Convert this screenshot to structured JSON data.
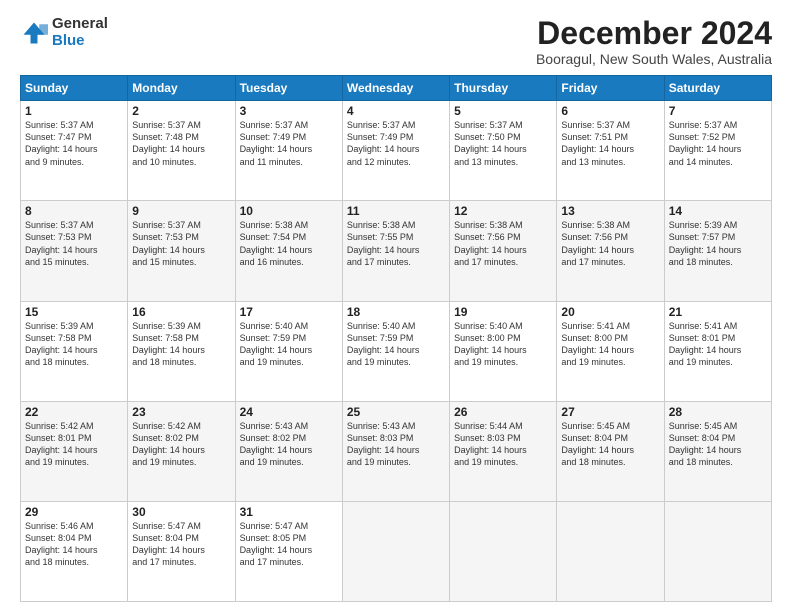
{
  "logo": {
    "general": "General",
    "blue": "Blue"
  },
  "header": {
    "title": "December 2024",
    "subtitle": "Booragul, New South Wales, Australia"
  },
  "weekdays": [
    "Sunday",
    "Monday",
    "Tuesday",
    "Wednesday",
    "Thursday",
    "Friday",
    "Saturday"
  ],
  "weeks": [
    [
      {
        "day": "1",
        "sunrise": "5:37 AM",
        "sunset": "7:47 PM",
        "daylight": "14 hours and 9 minutes."
      },
      {
        "day": "2",
        "sunrise": "5:37 AM",
        "sunset": "7:48 PM",
        "daylight": "14 hours and 10 minutes."
      },
      {
        "day": "3",
        "sunrise": "5:37 AM",
        "sunset": "7:49 PM",
        "daylight": "14 hours and 11 minutes."
      },
      {
        "day": "4",
        "sunrise": "5:37 AM",
        "sunset": "7:49 PM",
        "daylight": "14 hours and 12 minutes."
      },
      {
        "day": "5",
        "sunrise": "5:37 AM",
        "sunset": "7:50 PM",
        "daylight": "14 hours and 13 minutes."
      },
      {
        "day": "6",
        "sunrise": "5:37 AM",
        "sunset": "7:51 PM",
        "daylight": "14 hours and 13 minutes."
      },
      {
        "day": "7",
        "sunrise": "5:37 AM",
        "sunset": "7:52 PM",
        "daylight": "14 hours and 14 minutes."
      }
    ],
    [
      {
        "day": "8",
        "sunrise": "5:37 AM",
        "sunset": "7:53 PM",
        "daylight": "14 hours and 15 minutes."
      },
      {
        "day": "9",
        "sunrise": "5:37 AM",
        "sunset": "7:53 PM",
        "daylight": "14 hours and 15 minutes."
      },
      {
        "day": "10",
        "sunrise": "5:38 AM",
        "sunset": "7:54 PM",
        "daylight": "14 hours and 16 minutes."
      },
      {
        "day": "11",
        "sunrise": "5:38 AM",
        "sunset": "7:55 PM",
        "daylight": "14 hours and 17 minutes."
      },
      {
        "day": "12",
        "sunrise": "5:38 AM",
        "sunset": "7:56 PM",
        "daylight": "14 hours and 17 minutes."
      },
      {
        "day": "13",
        "sunrise": "5:38 AM",
        "sunset": "7:56 PM",
        "daylight": "14 hours and 17 minutes."
      },
      {
        "day": "14",
        "sunrise": "5:39 AM",
        "sunset": "7:57 PM",
        "daylight": "14 hours and 18 minutes."
      }
    ],
    [
      {
        "day": "15",
        "sunrise": "5:39 AM",
        "sunset": "7:58 PM",
        "daylight": "14 hours and 18 minutes."
      },
      {
        "day": "16",
        "sunrise": "5:39 AM",
        "sunset": "7:58 PM",
        "daylight": "14 hours and 18 minutes."
      },
      {
        "day": "17",
        "sunrise": "5:40 AM",
        "sunset": "7:59 PM",
        "daylight": "14 hours and 19 minutes."
      },
      {
        "day": "18",
        "sunrise": "5:40 AM",
        "sunset": "7:59 PM",
        "daylight": "14 hours and 19 minutes."
      },
      {
        "day": "19",
        "sunrise": "5:40 AM",
        "sunset": "8:00 PM",
        "daylight": "14 hours and 19 minutes."
      },
      {
        "day": "20",
        "sunrise": "5:41 AM",
        "sunset": "8:00 PM",
        "daylight": "14 hours and 19 minutes."
      },
      {
        "day": "21",
        "sunrise": "5:41 AM",
        "sunset": "8:01 PM",
        "daylight": "14 hours and 19 minutes."
      }
    ],
    [
      {
        "day": "22",
        "sunrise": "5:42 AM",
        "sunset": "8:01 PM",
        "daylight": "14 hours and 19 minutes."
      },
      {
        "day": "23",
        "sunrise": "5:42 AM",
        "sunset": "8:02 PM",
        "daylight": "14 hours and 19 minutes."
      },
      {
        "day": "24",
        "sunrise": "5:43 AM",
        "sunset": "8:02 PM",
        "daylight": "14 hours and 19 minutes."
      },
      {
        "day": "25",
        "sunrise": "5:43 AM",
        "sunset": "8:03 PM",
        "daylight": "14 hours and 19 minutes."
      },
      {
        "day": "26",
        "sunrise": "5:44 AM",
        "sunset": "8:03 PM",
        "daylight": "14 hours and 19 minutes."
      },
      {
        "day": "27",
        "sunrise": "5:45 AM",
        "sunset": "8:04 PM",
        "daylight": "14 hours and 18 minutes."
      },
      {
        "day": "28",
        "sunrise": "5:45 AM",
        "sunset": "8:04 PM",
        "daylight": "14 hours and 18 minutes."
      }
    ],
    [
      {
        "day": "29",
        "sunrise": "5:46 AM",
        "sunset": "8:04 PM",
        "daylight": "14 hours and 18 minutes."
      },
      {
        "day": "30",
        "sunrise": "5:47 AM",
        "sunset": "8:04 PM",
        "daylight": "14 hours and 17 minutes."
      },
      {
        "day": "31",
        "sunrise": "5:47 AM",
        "sunset": "8:05 PM",
        "daylight": "14 hours and 17 minutes."
      },
      null,
      null,
      null,
      null
    ]
  ]
}
